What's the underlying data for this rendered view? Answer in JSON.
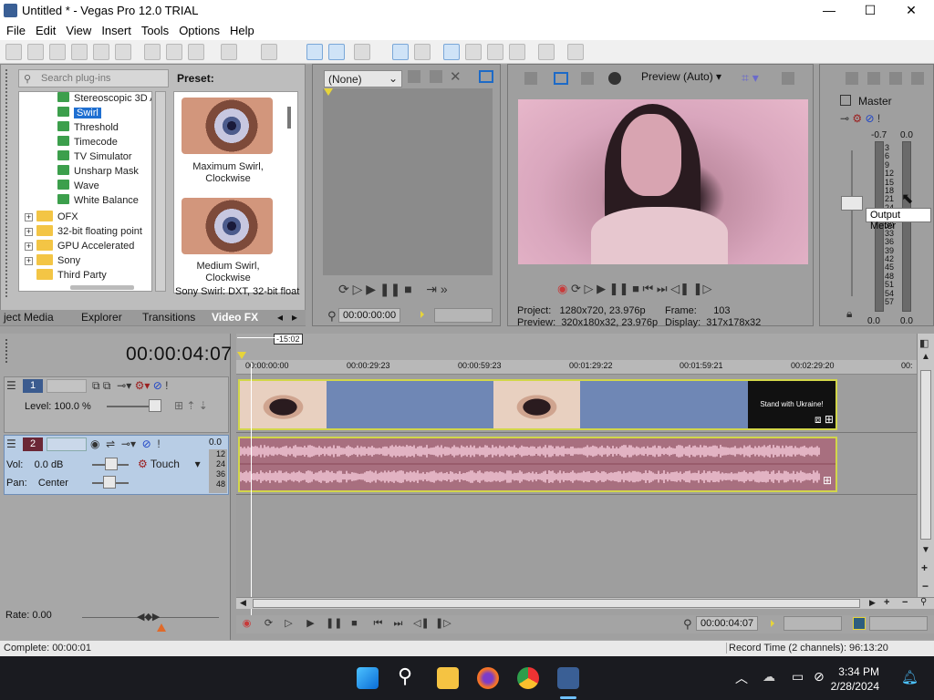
{
  "window": {
    "title": "Untitled * - Vegas Pro 12.0 TRIAL",
    "minimize": "—",
    "maximize": "☐",
    "close": "✕"
  },
  "menu": [
    "File",
    "Edit",
    "View",
    "Insert",
    "Tools",
    "Options",
    "Help"
  ],
  "plugins": {
    "search_placeholder": "Search plug-ins",
    "tree": [
      {
        "label": "Stereoscopic 3D A",
        "type": "fx"
      },
      {
        "label": "Swirl",
        "type": "fx",
        "selected": true
      },
      {
        "label": "Threshold",
        "type": "fx"
      },
      {
        "label": "Timecode",
        "type": "fx"
      },
      {
        "label": "TV Simulator",
        "type": "fx"
      },
      {
        "label": "Unsharp Mask",
        "type": "fx"
      },
      {
        "label": "Wave",
        "type": "fx"
      },
      {
        "label": "White Balance",
        "type": "fx"
      },
      {
        "label": "OFX",
        "type": "folder"
      },
      {
        "label": "32-bit floating point",
        "type": "folder"
      },
      {
        "label": "GPU Accelerated",
        "type": "folder"
      },
      {
        "label": "Sony",
        "type": "folder"
      },
      {
        "label": "Third Party",
        "type": "folder"
      }
    ],
    "preset_label": "Preset:",
    "presets": [
      {
        "name_line1": "Maximum Swirl,",
        "name_line2": "Clockwise"
      },
      {
        "name_line1": "Medium Swirl,",
        "name_line2": "Clockwise"
      }
    ],
    "plugin_desc": "Sony Swirl: DXT, 32-bit float"
  },
  "tabs": [
    {
      "label": "ject Media"
    },
    {
      "label": "Explorer"
    },
    {
      "label": "Transitions"
    },
    {
      "label": "Video FX",
      "active": true
    }
  ],
  "trimmer": {
    "dropdown": "(None)",
    "timecode": "00:00:00:00"
  },
  "preview": {
    "mode": "Preview (Auto)",
    "project_label": "Project:",
    "project_value": "1280x720, 23.976p",
    "preview_label": "Preview:",
    "preview_value": "320x180x32, 23.976p",
    "frame_label": "Frame:",
    "frame_value": "103",
    "display_label": "Display:",
    "display_value": "317x178x32"
  },
  "master": {
    "title": "Master",
    "left_peak": "-0.7",
    "right_peak": "0.0",
    "ticks": [
      "3",
      "6",
      "9",
      "12",
      "15",
      "18",
      "21",
      "24",
      "27",
      "30",
      "33",
      "36",
      "39",
      "42",
      "45",
      "48",
      "51",
      "54",
      "57"
    ],
    "bottom_left": "0.0",
    "bottom_right": "0.0",
    "tooltip": "Output Meter",
    "meter_levels": {
      "left": 0.0,
      "right": 0.0
    }
  },
  "timeline": {
    "time_display": "00:00:04:07",
    "selection_len": "-15:02",
    "ruler_labels": [
      "00:00:00:00",
      "00:00:29:23",
      "00:00:59:23",
      "00:01:29:22",
      "00:01:59:21",
      "00:02:29:20",
      "00:"
    ],
    "end_card_text": "Stand with Ukraine!",
    "track1": {
      "number": "1",
      "level_label": "Level:",
      "level_value": "100.0 %"
    },
    "track2": {
      "number": "2",
      "vol_label": "Vol:",
      "vol_value": "0.0 dB",
      "pan_label": "Pan:",
      "pan_value": "Center",
      "automation": "Touch",
      "meter_top": "0.0",
      "meter_ticks": [
        "12",
        "24",
        "36",
        "48"
      ]
    }
  },
  "transport": {
    "rate_label": "Rate:",
    "rate_value": "0.00",
    "timecode": "00:00:04:07"
  },
  "status": {
    "left": "Complete: 00:00:01",
    "right": "Record Time (2 channels): 96:13:20"
  },
  "taskbar": {
    "time": "3:34 PM",
    "date": "2/28/2024"
  },
  "colors": {
    "accent": "#1f6fd1",
    "clip_border": "#d2d64a",
    "video_clip": "#6f87b5",
    "audio_clip": "#a86f7f"
  }
}
